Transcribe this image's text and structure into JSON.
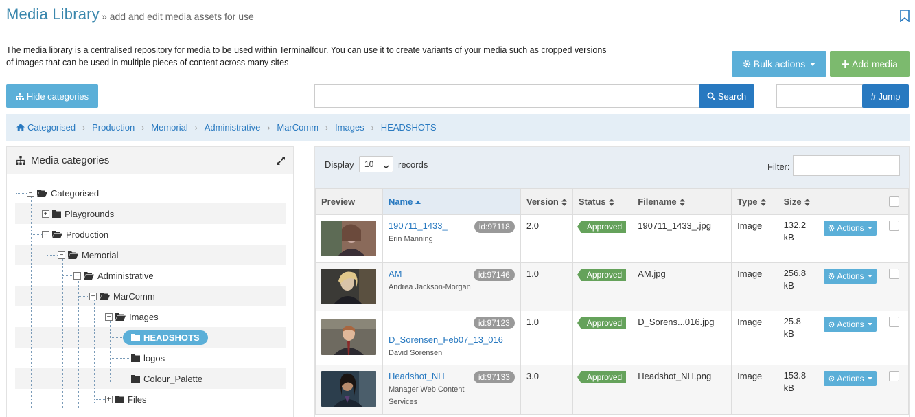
{
  "header": {
    "title": "Media Library",
    "subtitle": "» add and edit media assets for use"
  },
  "intro": "The media library is a centralised repository for media to be used within Terminalfour. You can use it to create variants of your media such as cropped versions of images that can be used in multiple pieces of content across many sites",
  "toolbar": {
    "bulk_actions": "Bulk actions",
    "add_media": "Add media",
    "hide_categories": "Hide categories",
    "search_button": "Search",
    "search_value": "",
    "jump_button": "# Jump",
    "jump_value": ""
  },
  "breadcrumb": [
    "Categorised",
    "Production",
    "Memorial",
    "Administrative",
    "MarComm",
    "Images",
    "HEADSHOTS"
  ],
  "categories": {
    "title": "Media categories",
    "tree": [
      {
        "label": "Categorised",
        "toggle": "⊟",
        "open": true
      },
      {
        "label": "Playgrounds",
        "toggle": "⊞",
        "open": false
      },
      {
        "label": "Production",
        "toggle": "⊟",
        "open": true
      },
      {
        "label": "Memorial",
        "toggle": "⊟",
        "open": true
      },
      {
        "label": "Administrative",
        "toggle": "⊟",
        "open": true
      },
      {
        "label": "MarComm",
        "toggle": "⊟",
        "open": true
      },
      {
        "label": "Images",
        "toggle": "⊟",
        "open": true
      },
      {
        "label": "HEADSHOTS",
        "toggle": "",
        "selected": true
      },
      {
        "label": "logos",
        "toggle": ""
      },
      {
        "label": "Colour_Palette",
        "toggle": ""
      },
      {
        "label": "Files",
        "toggle": "⊞",
        "open": false
      }
    ]
  },
  "table": {
    "display_label": "Display",
    "display_value": "10",
    "records_label": "records",
    "filter_label": "Filter:",
    "filter_value": "",
    "columns": [
      "Preview",
      "Name",
      "Version",
      "Status",
      "Filename",
      "Type",
      "Size",
      ""
    ],
    "rows": [
      {
        "name": "190711_1433_",
        "sub": "Erin Manning",
        "id": "id:97118",
        "version": "2.0",
        "status": "Approved",
        "filename": "190711_1433_.jpg",
        "type": "Image",
        "size": "132.2 kB",
        "actions": "Actions",
        "thumb_bg": "#8a6a5a",
        "thumb_fg": "#c9a9a0"
      },
      {
        "name": "AM",
        "sub": "Andrea Jackson-Morgan",
        "id": "id:97146",
        "version": "1.0",
        "status": "Approved",
        "filename": "AM.jpg",
        "type": "Image",
        "size": "256.8 kB",
        "actions": "Actions",
        "thumb_bg": "#3b3a36",
        "thumb_fg": "#d8c3a8"
      },
      {
        "name": "D_Sorensen_Feb07_13_016",
        "sub": "David Sorensen",
        "id": "id:97123",
        "version": "1.0",
        "status": "Approved",
        "filename": "D_Sorens...016.jpg",
        "type": "Image",
        "size": "25.8 kB",
        "actions": "Actions",
        "thumb_bg": "#6e6a60",
        "thumb_fg": "#a8663f"
      },
      {
        "name": "Headshot_NH",
        "sub": "Manager Web Content Services",
        "id": "id:97133",
        "version": "3.0",
        "status": "Approved",
        "filename": "Headshot_NH.png",
        "type": "Image",
        "size": "153.8 kB",
        "actions": "Actions",
        "thumb_bg": "#2c3e4d",
        "thumb_fg": "#b88b6c"
      }
    ]
  },
  "colors": {
    "accent_blue": "#2879c0",
    "light_blue_button": "#5bafd8",
    "green_button": "#7cba6e",
    "status_green": "#65a25b"
  }
}
